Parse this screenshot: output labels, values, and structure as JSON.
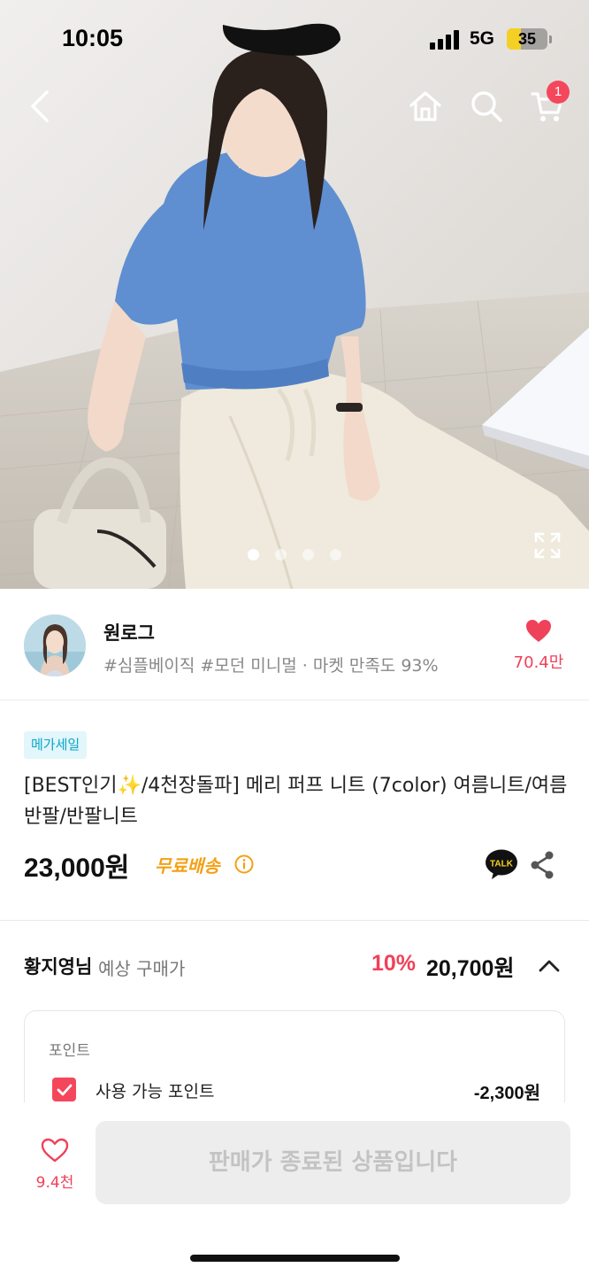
{
  "status_bar": {
    "time": "10:05",
    "network": "5G",
    "battery": "35",
    "battery_level": 0.35
  },
  "nav": {
    "back_icon": "chevron-left-icon",
    "home_icon": "home-icon",
    "search_icon": "search-icon",
    "cart_icon": "cart-icon",
    "cart_badge": "1"
  },
  "gallery": {
    "image_count": 4,
    "active_index": 0,
    "expand_icon": "expand-icon"
  },
  "seller": {
    "name": "원로그",
    "tags": "#심플베이직 #모던 미니멀 · 마켓 만족도 93%",
    "like_count": "70.4만"
  },
  "product": {
    "badge": "메가세일",
    "title": "[BEST인기✨/4천장돌파] 메리 퍼프 니트 (7color) 여름니트/여름반팔/반팔니트",
    "price": "23,000원",
    "shipping": "무료배송",
    "talk_label": "TALK"
  },
  "expected": {
    "name": "황지영님",
    "label": "예상 구매가",
    "discount_rate": "10%",
    "price": "20,700원"
  },
  "points": {
    "title": "포인트",
    "item_label": "사용 가능 포인트",
    "item_value": "-2,300원",
    "checked": true
  },
  "bottom": {
    "wish_count": "9.4천",
    "sold_out_label": "판매가 종료된 상품입니다"
  },
  "colors": {
    "accent": "#f0415a",
    "shipping": "#f4a013",
    "badge_text": "#0aa6c8",
    "badge_bg": "#e2f6fb"
  }
}
